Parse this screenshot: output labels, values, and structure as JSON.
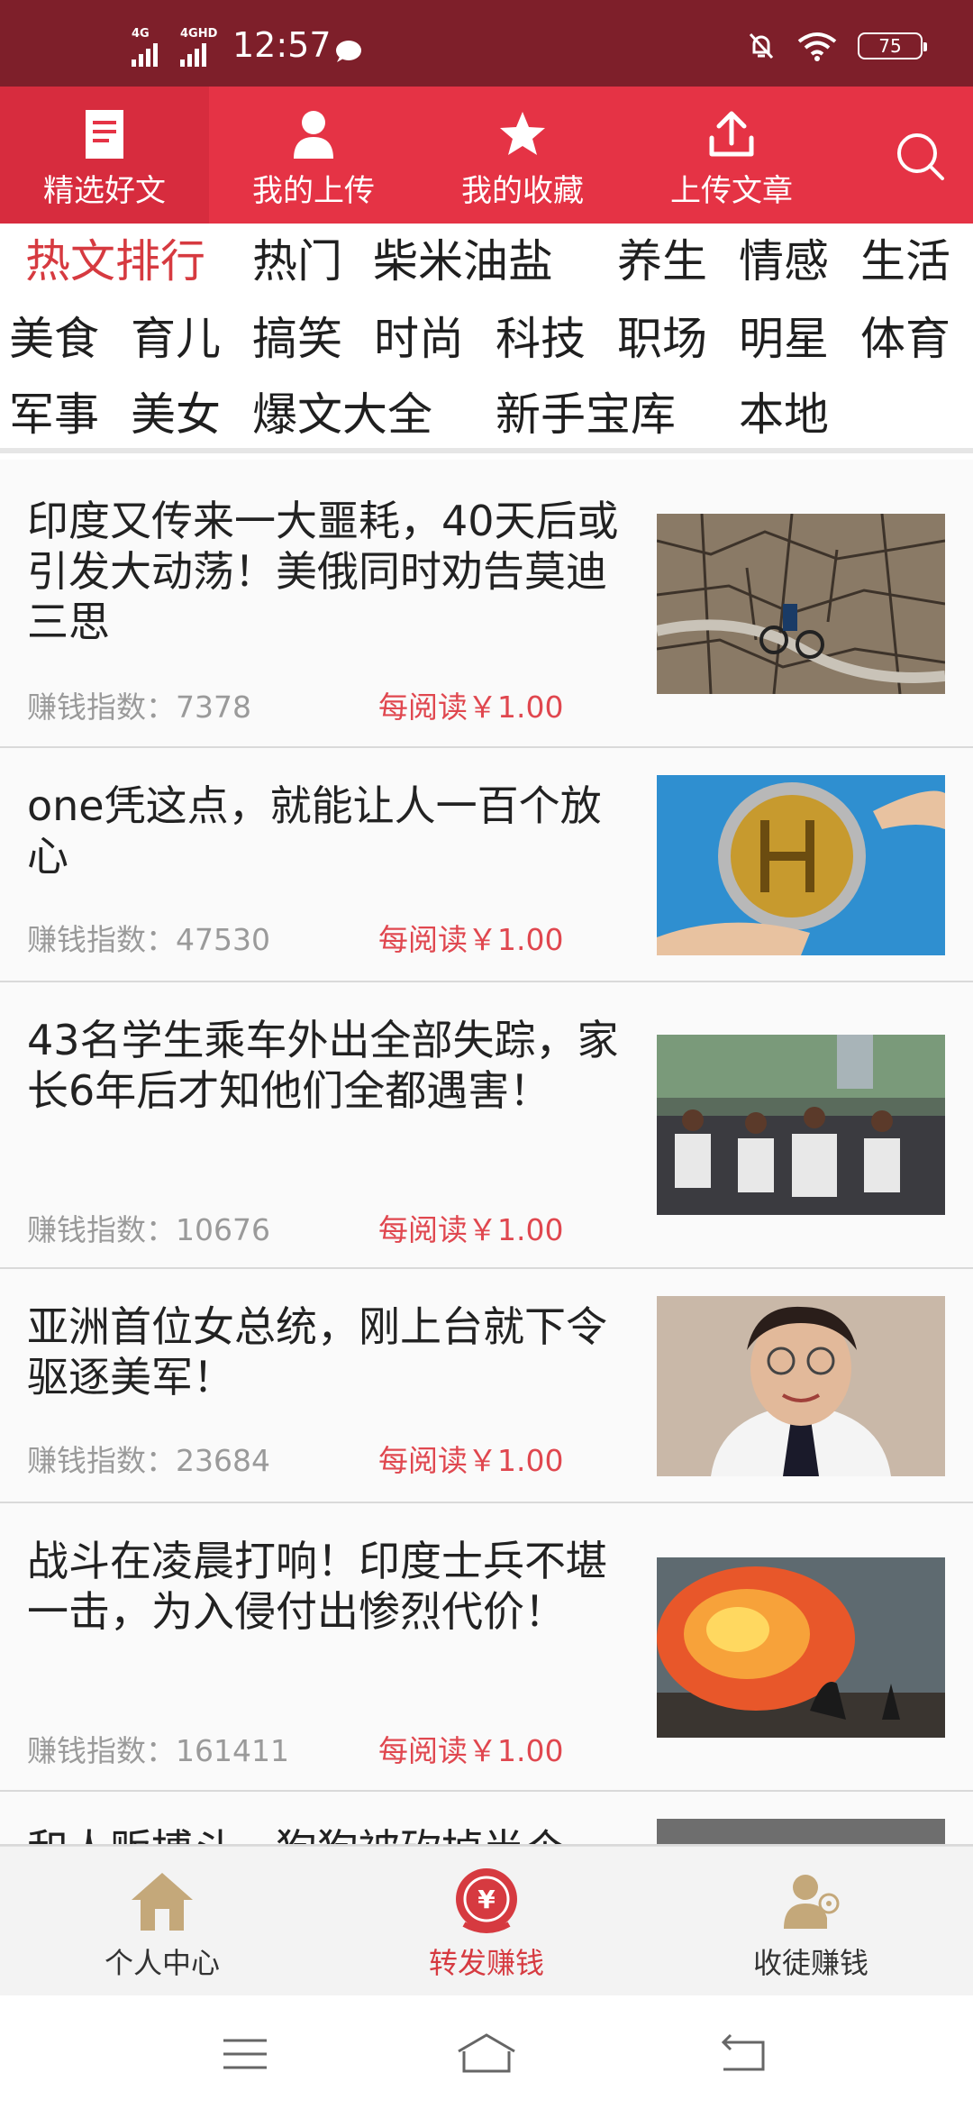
{
  "status_bar": {
    "signal_1": "4G",
    "signal_2": "4GHD",
    "time": "12:57",
    "battery": "75",
    "icons": [
      "message-icon",
      "mute-icon",
      "wifi-icon",
      "battery-icon"
    ]
  },
  "top_nav": {
    "items": [
      {
        "label": "精选好文",
        "icon": "document-icon",
        "active": true
      },
      {
        "label": "我的上传",
        "icon": "user-icon",
        "active": false
      },
      {
        "label": "我的收藏",
        "icon": "star-icon",
        "active": false
      },
      {
        "label": "上传文章",
        "icon": "upload-icon",
        "active": false
      }
    ],
    "search_icon": "search-icon"
  },
  "categories": [
    "热文排行",
    "热门",
    "柴米油盐",
    "养生",
    "情感",
    "生活",
    "美食",
    "育儿",
    "搞笑",
    "时尚",
    "科技",
    "职场",
    "明星",
    "体育",
    "军事",
    "美女",
    "爆文大全",
    "新手宝库",
    "本地"
  ],
  "articles": [
    {
      "title": "印度又传来一大噩耗，40天后或引发大动荡！美俄同时劝告莫迪三思",
      "index_label": "赚钱指数：7378",
      "reward": "每阅读￥1.00",
      "thumb": "cracked-earth-cyclist-photo"
    },
    {
      "title": "one凭这点，就能让人一百个放心",
      "index_label": "赚钱指数：47530",
      "reward": "每阅读￥1.00",
      "thumb": "gold-coin-hands-photo"
    },
    {
      "title": "43名学生乘车外出全部失踪，家长6年后才知他们全都遇害！",
      "index_label": "赚钱指数：10676",
      "reward": "每阅读￥1.00",
      "thumb": "street-protest-photo"
    },
    {
      "title": "亚洲首位女总统，刚上台就下令驱逐美军！",
      "index_label": "赚钱指数：23684",
      "reward": "每阅读￥1.00",
      "thumb": "woman-portrait-photo"
    },
    {
      "title": "战斗在凌晨打响！印度士兵不堪一击，为入侵付出惨烈代价！",
      "index_label": "赚钱指数：161411",
      "reward": "每阅读￥1.00",
      "thumb": "explosion-photo"
    },
    {
      "title": "和人贩搏斗，狗狗被砍掉半个",
      "index_label": "",
      "reward": "",
      "thumb": "partial-photo"
    }
  ],
  "bottom_tabs": [
    {
      "label": "个人中心",
      "icon": "home-icon",
      "active": false
    },
    {
      "label": "转发赚钱",
      "icon": "yuan-coin-icon",
      "active": true
    },
    {
      "label": "收徒赚钱",
      "icon": "person-add-icon",
      "active": false
    }
  ],
  "colors": {
    "status_bar": "#7e1f2a",
    "nav_bg": "#e53345",
    "accent_red": "#d63a40",
    "tab_icon_gold": "#c4a87a"
  }
}
